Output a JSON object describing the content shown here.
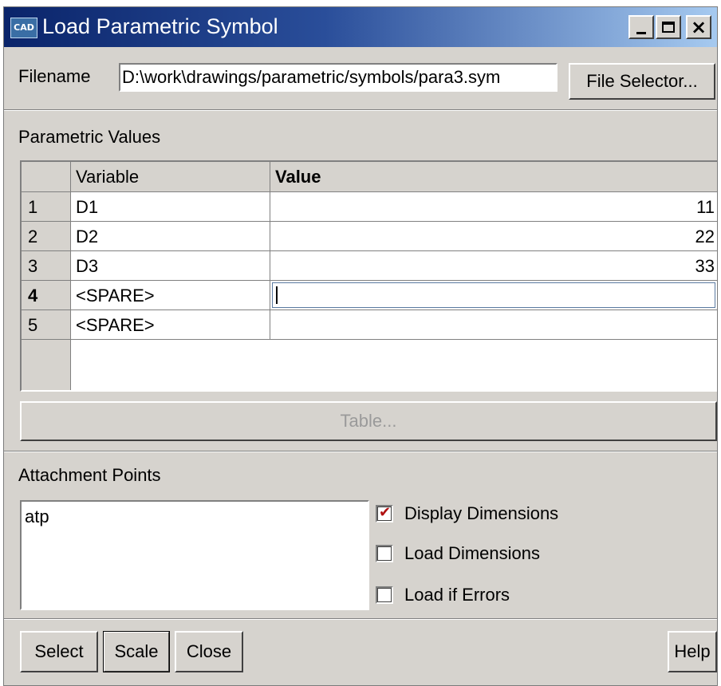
{
  "window": {
    "title": "Load Parametric Symbol",
    "icon_text": "CAD",
    "controls": {
      "minimize": "minimize",
      "maximize": "maximize",
      "close": "×"
    }
  },
  "filename": {
    "label": "Filename",
    "value": "D:\\work\\drawings/parametric/symbols/para3.sym",
    "selector_button": "File Selector..."
  },
  "parametric": {
    "section_label": "Parametric Values",
    "columns": {
      "variable": "Variable",
      "value": "Value"
    },
    "rows": [
      {
        "index": "1",
        "variable": "D1",
        "value": "11"
      },
      {
        "index": "2",
        "variable": "D2",
        "value": "22"
      },
      {
        "index": "3",
        "variable": "D3",
        "value": "33"
      },
      {
        "index": "4",
        "variable": "<SPARE>",
        "value": ""
      },
      {
        "index": "5",
        "variable": "<SPARE>",
        "value": ""
      }
    ],
    "active_row_index": "4",
    "table_button": "Table..."
  },
  "attachment": {
    "section_label": "Attachment Points",
    "items": [
      "atp"
    ]
  },
  "options": [
    {
      "label": "Display Dimensions",
      "checked": true
    },
    {
      "label": "Load Dimensions",
      "checked": false
    },
    {
      "label": "Load if Errors",
      "checked": false
    }
  ],
  "footer": {
    "select": "Select",
    "scale": "Scale",
    "close": "Close",
    "help": "Help"
  }
}
